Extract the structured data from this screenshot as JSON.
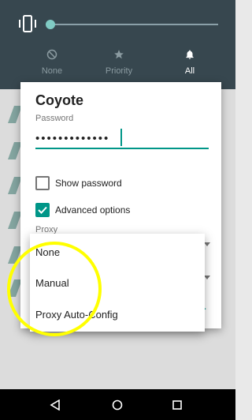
{
  "volume_panel": {
    "icon": "vibrate-icon",
    "modes": [
      {
        "label": "None",
        "icon": "block-icon",
        "selected": false
      },
      {
        "label": "Priority",
        "icon": "star-icon",
        "selected": false
      },
      {
        "label": "All",
        "icon": "bell-icon",
        "selected": true
      }
    ]
  },
  "dialog": {
    "title": "Coyote",
    "password_label": "Password",
    "password_value": "•••••••••••••",
    "show_password": {
      "label": "Show password",
      "checked": false
    },
    "advanced_options": {
      "label": "Advanced options",
      "checked": true
    },
    "proxy_label": "Proxy",
    "partial_button_text": "T"
  },
  "proxy_dropdown": {
    "options": [
      "None",
      "Manual",
      "Proxy Auto-Config"
    ]
  },
  "nav_bar": {
    "buttons": [
      "back-icon",
      "home-icon",
      "recents-icon"
    ]
  },
  "colors": {
    "accent": "#009688",
    "shade": "#37474f",
    "annotation": "#ffff00"
  }
}
